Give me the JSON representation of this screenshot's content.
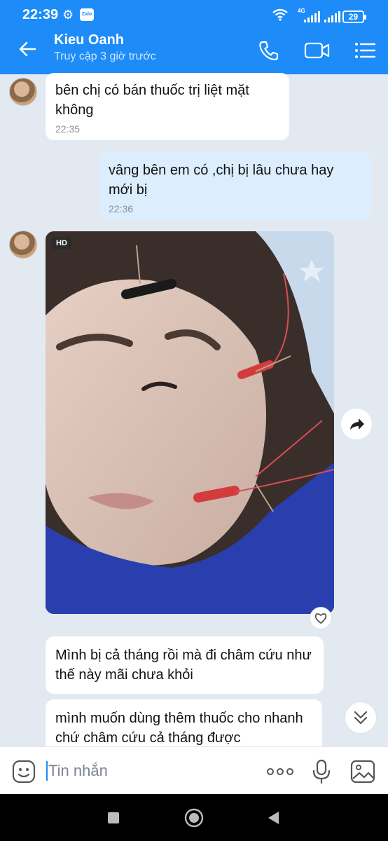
{
  "status": {
    "time": "22:39",
    "network": "4G",
    "battery": "29"
  },
  "header": {
    "contact_name": "Kieu Oanh",
    "last_seen": "Truy cập 3 giờ trước"
  },
  "messages": [
    {
      "from": "contact",
      "text": "bên chị có bán thuốc trị liệt mặt không",
      "time": "22:35"
    },
    {
      "from": "me",
      "text": "vâng bên em có ,chị bị lâu chưa hay mới bị",
      "time": "22:36"
    },
    {
      "from": "contact",
      "type": "photo",
      "badge": "HD"
    },
    {
      "from": "contact",
      "text": "Mình bị cả tháng rồi mà đi châm cứu như thế này mãi chưa khỏi"
    },
    {
      "from": "contact",
      "text": "mình muốn dùng thêm thuốc cho nhanh chứ châm cứu cả tháng được"
    }
  ],
  "composer": {
    "placeholder": "Tin nhắn"
  },
  "icons": {
    "back": "arrow-left-icon",
    "call": "phone-icon",
    "video": "video-camera-icon",
    "menu": "list-menu-icon",
    "share": "share-arrow-icon",
    "heart": "heart-icon",
    "scroll": "double-chevron-down-icon",
    "emoji": "emoji-icon",
    "more": "more-dots-icon",
    "mic": "microphone-icon",
    "image": "image-icon"
  },
  "colors": {
    "brand": "#1d8cf8",
    "incoming_bubble": "#ffffff",
    "outgoing_bubble": "#dcedfd",
    "chat_bg": "#e2e9f1"
  }
}
